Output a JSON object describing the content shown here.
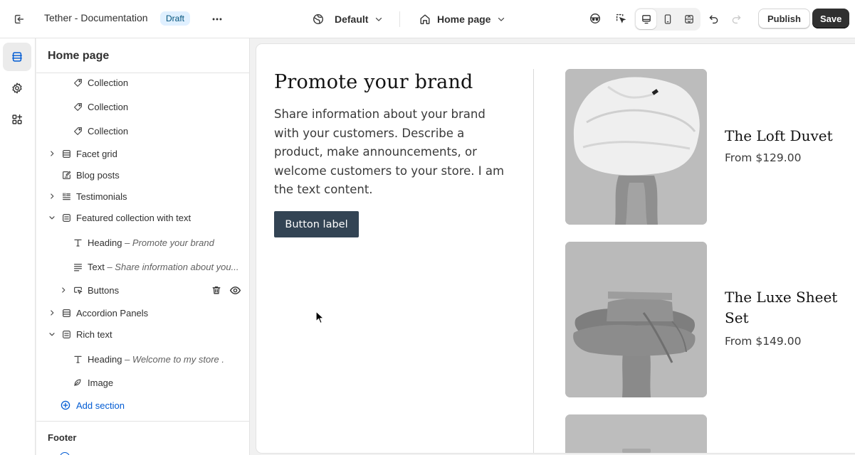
{
  "topbar": {
    "title": "Tether - Documentation",
    "status_badge": "Draft",
    "theme": "Default",
    "page": "Home page",
    "publish_label": "Publish",
    "save_label": "Save"
  },
  "sidebar": {
    "title": "Home page",
    "items": [
      {
        "label": "Collection",
        "icon": "tag-icon"
      },
      {
        "label": "Collection",
        "icon": "tag-icon"
      },
      {
        "label": "Collection",
        "icon": "tag-icon"
      },
      {
        "label": "Facet grid",
        "icon": "grid-section-icon"
      },
      {
        "label": "Blog posts",
        "icon": "blog-icon"
      },
      {
        "label": "Testimonials",
        "icon": "testimonials-icon"
      },
      {
        "label": "Featured collection with text",
        "icon": "section-icon"
      },
      {
        "label": "Heading",
        "sub": "– Promote your brand",
        "icon": "text-type-icon"
      },
      {
        "label": "Text",
        "sub": "– Share information about you...",
        "icon": "text-lines-icon"
      },
      {
        "label": "Buttons",
        "icon": "button-block-icon"
      },
      {
        "label": "Accordion Panels",
        "icon": "grid-section-icon"
      },
      {
        "label": "Rich text",
        "icon": "section-icon"
      },
      {
        "label": "Heading",
        "sub": "– Welcome to my store .",
        "icon": "text-type-icon"
      },
      {
        "label": "Image",
        "icon": "image-block-icon"
      }
    ],
    "add_section": "Add section",
    "footer": "Footer"
  },
  "preview": {
    "heading": "Promote your brand",
    "text": "Share information about your brand with your customers. Describe a product, make announcements, or welcome customers to your store. I am the text content.",
    "button": "Button label",
    "products": [
      {
        "title": "The Loft Duvet",
        "price": "From $129.00"
      },
      {
        "title": "The Luxe Sheet Set",
        "price": "From $149.00"
      }
    ]
  },
  "colors": {
    "accent": "#005bd3",
    "save_button": "#303030",
    "badge_bg": "#e0f0ff",
    "preview_button": "#334454"
  }
}
